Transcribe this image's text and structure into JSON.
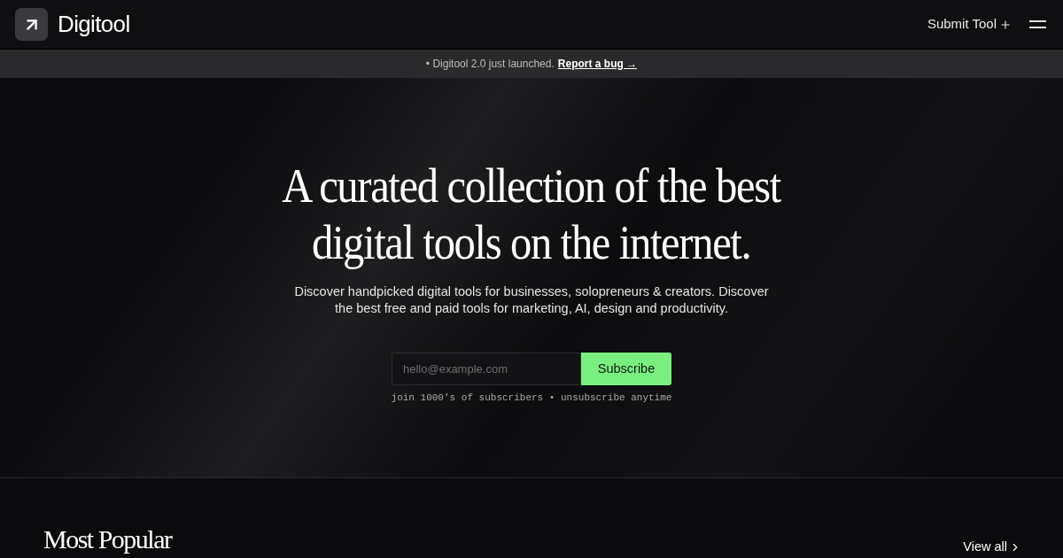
{
  "header": {
    "logo": "Digitool",
    "submit": "Submit Tool"
  },
  "banner": {
    "text": "• Digitool 2.0 just launched.",
    "link": "Report a bug →"
  },
  "hero": {
    "title_lines": [
      "A curated collection of the best",
      "digital tools on the internet."
    ],
    "subtitle_lines": [
      "Discover handpicked digital tools for businesses, solopreneurs & creators. Discover",
      "the best free and paid tools for marketing, AI, design and productivity."
    ],
    "email": {
      "placeholder": "hello@example.com"
    },
    "subscribe": "Subscribe",
    "note": "join 1000’s of subscribers • unsubscribe anytime"
  },
  "section": {
    "title": "Most Popular",
    "view_all": "View all"
  }
}
